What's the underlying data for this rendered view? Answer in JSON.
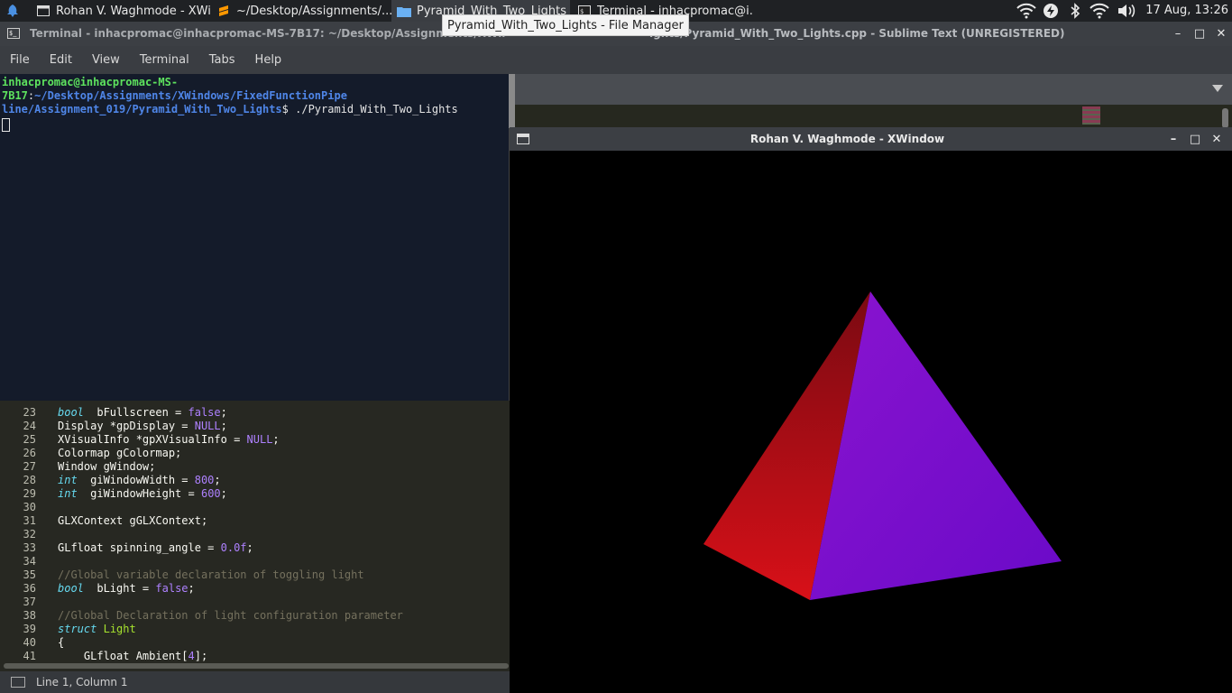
{
  "taskbar": {
    "tasks": [
      {
        "label": "Rohan V. Waghmode - XWi...",
        "icon": "window-icon"
      },
      {
        "label": "~/Desktop/Assignments/...",
        "icon": "sublime-icon"
      },
      {
        "label": "Pyramid_With_Two_Lights",
        "icon": "folder-icon"
      },
      {
        "label": "Terminal - inhacpromac@i...",
        "icon": "terminal-icon"
      }
    ],
    "clock": "17 Aug, 13:26"
  },
  "tooltip": "Pyramid_With_Two_Lights - File Manager",
  "sublime": {
    "title": "ights/Pyramid_With_Two_Lights.cpp - Sublime Text (UNREGISTERED)",
    "status": "Line 1, Column 1",
    "code": [
      {
        "ln": "23",
        "parts": [
          [
            "kw",
            "bool"
          ],
          [
            "",
            "  bFullscreen = "
          ],
          [
            "num",
            "false"
          ],
          [
            "",
            ";"
          ]
        ]
      },
      {
        "ln": "24",
        "parts": [
          [
            "",
            "Display *gpDisplay = "
          ],
          [
            "num",
            "NULL"
          ],
          [
            "",
            ";"
          ]
        ]
      },
      {
        "ln": "25",
        "parts": [
          [
            "",
            "XVisualInfo *gpXVisualInfo = "
          ],
          [
            "num",
            "NULL"
          ],
          [
            "",
            ";"
          ]
        ]
      },
      {
        "ln": "26",
        "parts": [
          [
            "",
            "Colormap gColormap;"
          ]
        ]
      },
      {
        "ln": "27",
        "parts": [
          [
            "",
            "Window gWindow;"
          ]
        ]
      },
      {
        "ln": "28",
        "parts": [
          [
            "kw",
            "int"
          ],
          [
            "",
            "  giWindowWidth = "
          ],
          [
            "num",
            "800"
          ],
          [
            "",
            ";"
          ]
        ]
      },
      {
        "ln": "29",
        "parts": [
          [
            "kw",
            "int"
          ],
          [
            "",
            "  giWindowHeight = "
          ],
          [
            "num",
            "600"
          ],
          [
            "",
            ";"
          ]
        ]
      },
      {
        "ln": "30",
        "parts": []
      },
      {
        "ln": "31",
        "parts": [
          [
            "",
            "GLXContext gGLXContext;"
          ]
        ]
      },
      {
        "ln": "32",
        "parts": []
      },
      {
        "ln": "33",
        "parts": [
          [
            "",
            "GLfloat spinning_angle = "
          ],
          [
            "num",
            "0.0f"
          ],
          [
            "",
            ";"
          ]
        ]
      },
      {
        "ln": "34",
        "parts": []
      },
      {
        "ln": "35",
        "parts": [
          [
            "cm",
            "//Global variable declaration of toggling light"
          ]
        ]
      },
      {
        "ln": "36",
        "parts": [
          [
            "kw",
            "bool"
          ],
          [
            "",
            "  bLight = "
          ],
          [
            "num",
            "false"
          ],
          [
            "",
            ";"
          ]
        ]
      },
      {
        "ln": "37",
        "parts": []
      },
      {
        "ln": "38",
        "parts": [
          [
            "cm",
            "//Global Declaration of light configuration parameter"
          ]
        ]
      },
      {
        "ln": "39",
        "parts": [
          [
            "kw",
            "struct"
          ],
          [
            "",
            " "
          ],
          [
            "ty",
            "Light"
          ]
        ]
      },
      {
        "ln": "40",
        "parts": [
          [
            "",
            "{"
          ]
        ]
      },
      {
        "ln": "41",
        "parts": [
          [
            "",
            "    GLfloat Ambient["
          ],
          [
            "num",
            "4"
          ],
          [
            "",
            "];"
          ]
        ]
      }
    ]
  },
  "terminal": {
    "title": "Terminal - inhacpromac@inhacpromac-MS-7B17: ~/Desktop/Assignments/XWindows/FixedFunctionPipeline/Assignment_019/Pyramid_With_Two_Lights",
    "menu": [
      "File",
      "Edit",
      "View",
      "Terminal",
      "Tabs",
      "Help"
    ],
    "prompt_user": "inhacpromac@inhacpromac-MS-7B17",
    "prompt_path": "~/Desktop/Assignments/XWindows/FixedFunctionPipeline/Assignment_019/Pyramid_With_Two_Lights",
    "prompt_path_line1": "~/Desktop/Assignments/XWindows/FixedFunctionPipe",
    "prompt_path_line2": "line/Assignment_019/Pyramid_With_Two_Lights",
    "command": "$ ./Pyramid_With_Two_Lights"
  },
  "xwindow": {
    "title": "Rohan V. Waghmode - XWindow",
    "pyramid": {
      "left_face_colors": [
        "#7a0a12",
        "#d81018"
      ],
      "right_face_colors": [
        "#8a14cf",
        "#6a0ac8"
      ]
    }
  }
}
